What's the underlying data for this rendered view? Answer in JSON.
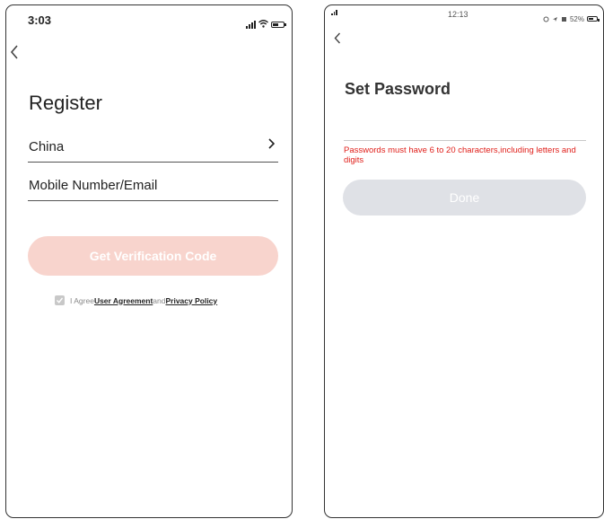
{
  "register_screen": {
    "status": {
      "time": "3:03"
    },
    "title": "Register",
    "country_field": {
      "label": "China"
    },
    "account_field": {
      "label": "Mobile Number/Email"
    },
    "verify_button": {
      "label": "Get Verification Code",
      "color": "#f8d4cd"
    },
    "agreement": {
      "checked": true,
      "prefix": "I Agree",
      "user_agreement_link": "User Agreement",
      "conjunction": "and",
      "privacy_policy_link": "Privacy Policy"
    }
  },
  "password_screen": {
    "status": {
      "time": "12:13",
      "battery": "52%"
    },
    "title": "Set Password",
    "password_input": {
      "value": "",
      "placeholder": ""
    },
    "hint": {
      "text": "Passwords must have 6 to 20 characters,including letters and digits",
      "color": "#e0201b"
    },
    "done_button": {
      "label": "Done",
      "color": "#dfe1e6"
    }
  }
}
